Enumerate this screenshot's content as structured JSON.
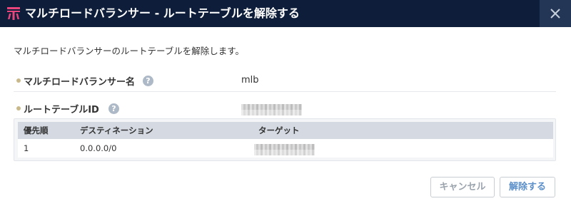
{
  "dialog": {
    "title": "マルチロードバランサー - ルートテーブルを解除する",
    "description": "マルチロードバランサーのルートテーブルを解除します。"
  },
  "fields": {
    "mlb_name": {
      "label": "マルチロードバランサー名",
      "value": "mlb",
      "help": "?"
    },
    "route_table_id": {
      "label": "ルートテーブルID",
      "help": "?",
      "value_redacted": true
    }
  },
  "table": {
    "headers": [
      "優先順",
      "デスティネーション",
      "ターゲット"
    ],
    "rows": [
      {
        "priority": "1",
        "destination": "0.0.0.0/0",
        "target_redacted": true
      }
    ]
  },
  "buttons": {
    "cancel": "キャンセル",
    "release": "解除する"
  },
  "icons": {
    "app": "nifcloud-logo-icon",
    "close": "close-icon",
    "help": "help-icon"
  },
  "colors": {
    "titlebar": "#0e1e3a",
    "close_bg": "#233656",
    "accent": "#5b8fc9",
    "logo": "#e8457c"
  }
}
